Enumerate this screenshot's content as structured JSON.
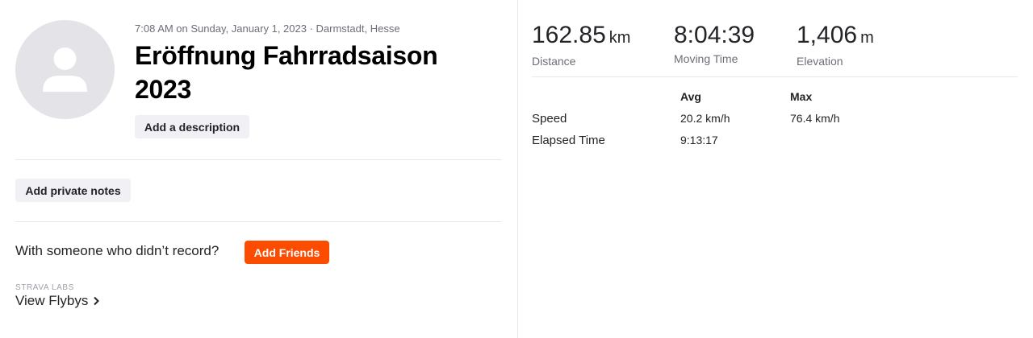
{
  "activity": {
    "meta": "7:08 AM on Sunday, January 1, 2023 · Darmstadt, Hesse",
    "title": "Eröffnung Fahrradsaison 2023",
    "add_description_label": "Add a description",
    "add_private_notes_label": "Add private notes"
  },
  "friends": {
    "prompt": "With someone who didn’t record?",
    "button_label": "Add Friends"
  },
  "labs": {
    "label": "STRAVA LABS",
    "flybys_label": "View Flybys"
  },
  "stats": {
    "distance": {
      "value": "162.85",
      "unit": "km",
      "label": "Distance"
    },
    "moving_time": {
      "value": "8:04:39",
      "label": "Moving Time"
    },
    "elevation": {
      "value": "1,406",
      "unit": "m",
      "label": "Elevation"
    }
  },
  "table": {
    "headers": {
      "avg": "Avg",
      "max": "Max"
    },
    "rows": [
      {
        "label": "Speed",
        "avg": "20.2 km/h",
        "max": "76.4 km/h"
      },
      {
        "label": "Elapsed Time",
        "avg": "9:13:17",
        "max": ""
      }
    ]
  },
  "colors": {
    "accent": "#fc4c02",
    "avatar_bg": "#e3e3e8",
    "button_bg": "#f0f0f5"
  },
  "icons": {
    "avatar": "user-silhouette-icon",
    "flybys_chevron": "chevron-right-icon"
  }
}
